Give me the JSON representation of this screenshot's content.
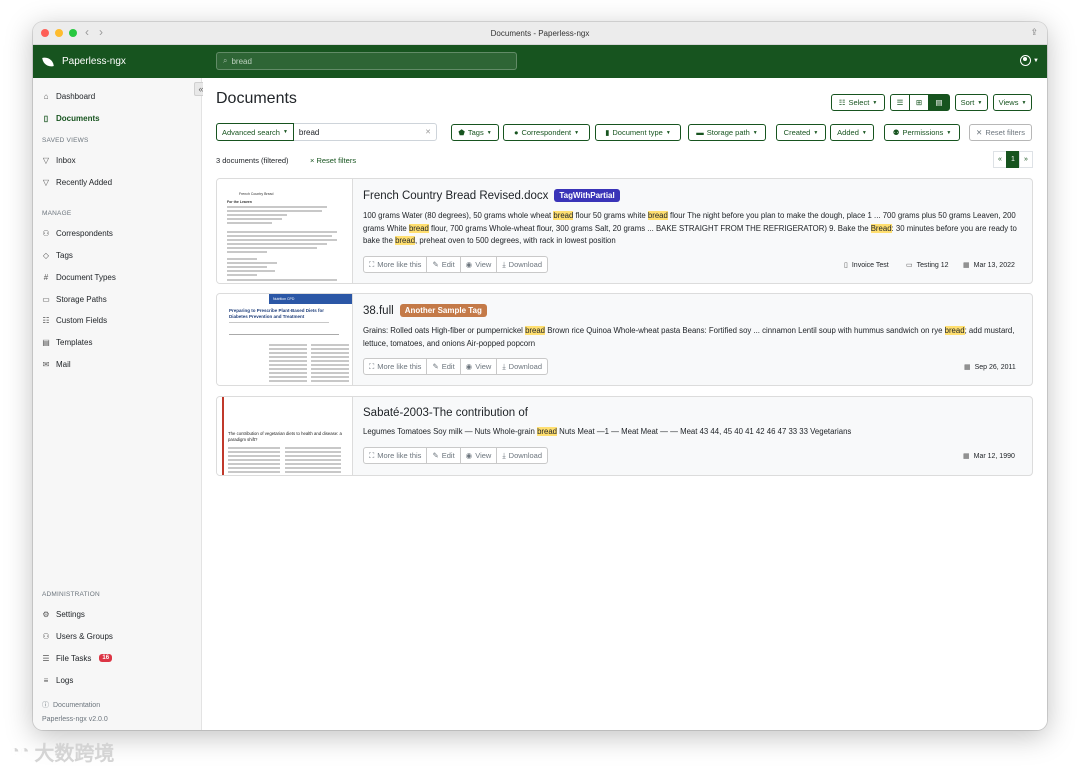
{
  "window": {
    "title": "Documents - Paperless-ngx"
  },
  "app": {
    "name": "Paperless-ngx"
  },
  "global_search": {
    "value": "bread"
  },
  "sidebar": {
    "top_items": [
      {
        "label": "Dashboard",
        "icon": "house-icon"
      },
      {
        "label": "Documents",
        "icon": "file-icon",
        "active": true
      }
    ],
    "saved_views_label": "SAVED VIEWS",
    "saved_views": [
      {
        "label": "Inbox",
        "icon": "funnel-icon"
      },
      {
        "label": "Recently Added",
        "icon": "funnel-icon"
      }
    ],
    "manage_label": "MANAGE",
    "manage_items": [
      {
        "label": "Correspondents",
        "icon": "person-icon"
      },
      {
        "label": "Tags",
        "icon": "tag-icon"
      },
      {
        "label": "Document Types",
        "icon": "hash-icon"
      },
      {
        "label": "Storage Paths",
        "icon": "folder-icon"
      },
      {
        "label": "Custom Fields",
        "icon": "ui-radios-icon"
      },
      {
        "label": "Templates",
        "icon": "file-text-icon"
      },
      {
        "label": "Mail",
        "icon": "envelope-icon"
      }
    ],
    "admin_label": "ADMINISTRATION",
    "admin_items": [
      {
        "label": "Settings",
        "icon": "gear-icon"
      },
      {
        "label": "Users & Groups",
        "icon": "people-icon"
      },
      {
        "label": "File Tasks",
        "icon": "list-task-icon",
        "badge": "16"
      },
      {
        "label": "Logs",
        "icon": "text-left-icon"
      }
    ],
    "documentation_label": "Documentation",
    "version": "Paperless-ngx v2.0.0"
  },
  "page": {
    "title": "Documents"
  },
  "toolbar": {
    "select_label": "Select",
    "sort_label": "Sort",
    "views_label": "Views"
  },
  "filters": {
    "advanced_search_label": "Advanced search",
    "search_value": "bread",
    "tags_label": "Tags",
    "correspondent_label": "Correspondent",
    "document_type_label": "Document type",
    "storage_path_label": "Storage path",
    "created_label": "Created",
    "added_label": "Added",
    "permissions_label": "Permissions",
    "reset_filters_label": "Reset filters"
  },
  "results": {
    "count_text": "3 documents (filtered)",
    "reset_link": "Reset filters"
  },
  "pagination": {
    "prev": "«",
    "current": "1",
    "next": "»"
  },
  "card_actions": {
    "more_like_this": "More like this",
    "edit": "Edit",
    "view": "View",
    "download": "Download"
  },
  "documents": [
    {
      "title": "French Country Bread Revised.docx",
      "tag": {
        "label": "TagWithPartial",
        "color": "#3a34b8"
      },
      "snippet_parts": [
        "100 grams Water (80 degrees), 50 grams whole wheat ",
        "bread",
        " flour 50 grams white ",
        "bread",
        " flour The night before you plan to make the dough, place 1 ... 700 grams plus 50 grams Leaven, 200 grams White ",
        "bread",
        " flour, 700 grams Whole-wheat flour, 300 grams Salt, 20 grams ... BAKE STRAIGHT FROM THE REFRIGERATOR) 9. Bake the ",
        "Bread",
        ": 30 minutes before you are ready to bake the ",
        "bread",
        ", preheat oven to 500 degrees, with rack in lowest position"
      ],
      "document_type": "Invoice Test",
      "storage_path": "Testing 12",
      "date": "Mar 13, 2022"
    },
    {
      "title": "38.full",
      "tag": {
        "label": "Another Sample Tag",
        "color": "#c47a48"
      },
      "snippet_parts": [
        "Grains: Rolled oats High-fiber or pumpernickel ",
        "bread",
        " Brown rice Quinoa Whole-wheat pasta Beans: Fortified soy ... cinnamon Lentil soup with hummus sandwich on rye ",
        "bread",
        "; add mustard, lettuce, tomatoes, and onions Air-popped popcorn"
      ],
      "date": "Sep 26, 2011"
    },
    {
      "title": "Sabaté-2003-The contribution of",
      "snippet_parts": [
        "Legumes Tomatoes Soy milk — Nuts Whole-grain ",
        "bread",
        " Nuts Meat —1 — Meat Meat — — Meat 43 44, 45 40 41 42 46 47 33 33 Vegetarians"
      ],
      "date": "Mar 12, 1990"
    }
  ],
  "thumbnails": {
    "doc1": {
      "title": "French Country Bread",
      "subtitle": "For the Leaven"
    },
    "doc2": {
      "header": "Nutrition CPD",
      "title": "Preparing to Prescribe Plant-Based Diets for Diabetes Prevention and Treatment"
    },
    "doc3": {
      "title": "The contribution of vegetarian diets to health and disease: a paradigm shift?"
    }
  },
  "colors": {
    "primary": "#17541f",
    "highlight": "#ffdf70",
    "badge_danger": "#dc3545"
  },
  "watermark": "大数跨境"
}
